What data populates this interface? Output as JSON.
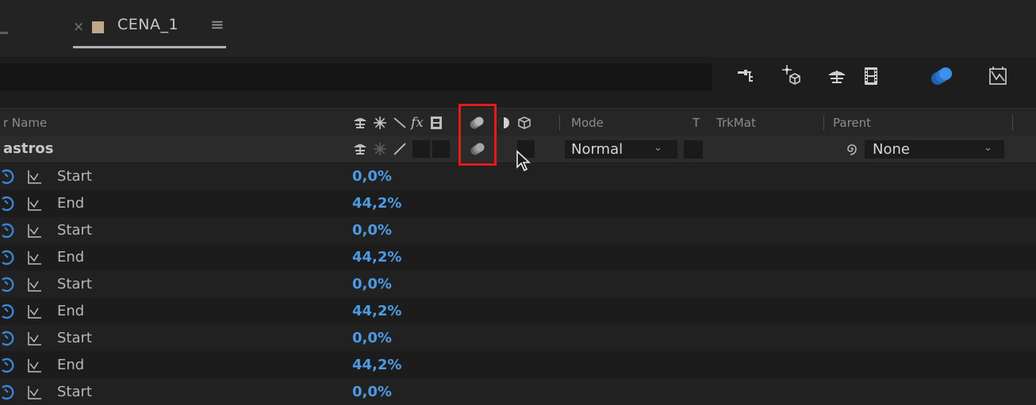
{
  "tab": {
    "close": "×",
    "label": "CENA_1",
    "menu": "≡"
  },
  "headers": {
    "name": "r Name",
    "mode": "Mode",
    "t": "T",
    "trkmat": "TrkMat",
    "parent": "Parent"
  },
  "layer": {
    "name": "astros",
    "mode": "Normal",
    "parent": "None"
  },
  "properties": [
    {
      "name": "Start",
      "value": "0,0%"
    },
    {
      "name": "End",
      "value": "44,2%"
    },
    {
      "name": "Start",
      "value": "0,0%"
    },
    {
      "name": "End",
      "value": "44,2%"
    },
    {
      "name": "Start",
      "value": "0,0%"
    },
    {
      "name": "End",
      "value": "44,2%"
    },
    {
      "name": "Start",
      "value": "0,0%"
    },
    {
      "name": "End",
      "value": "44,2%"
    },
    {
      "name": "Start",
      "value": "0,0%"
    }
  ],
  "colors": {
    "value_blue": "#4d9be6",
    "highlight": "#e21b1b",
    "tab_swatch": "#bfa889",
    "motion_blur_blue": "#2f7fe0"
  }
}
